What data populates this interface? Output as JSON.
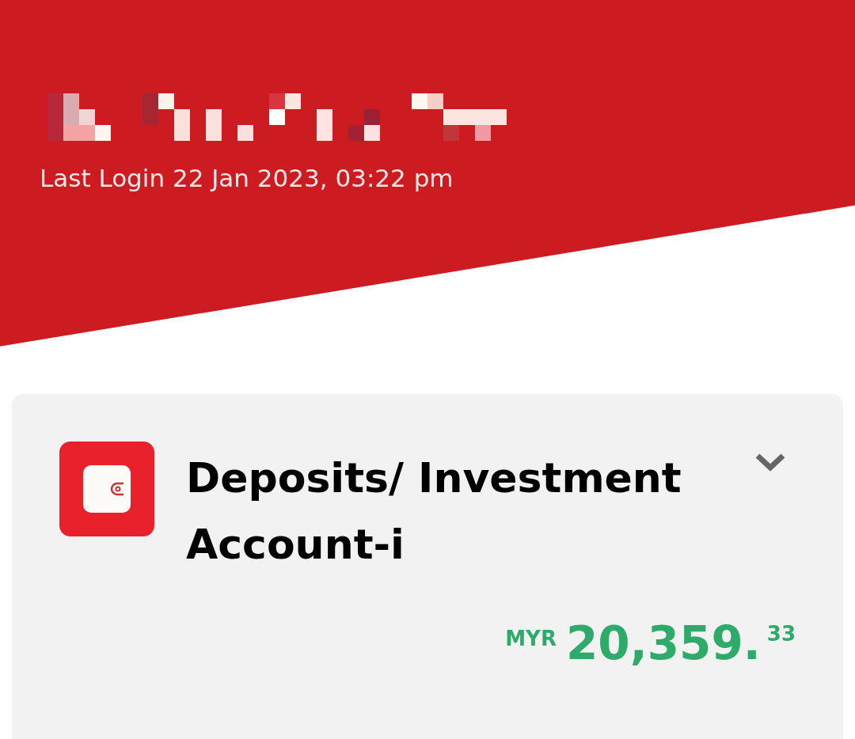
{
  "header": {
    "last_login": "Last Login 22 Jan 2023, 03:22 pm"
  },
  "account_card": {
    "title": "Deposits/ Investment Account-i",
    "expanded": false,
    "currency": "MYR",
    "amount": "20,359.",
    "cents": "33"
  }
}
